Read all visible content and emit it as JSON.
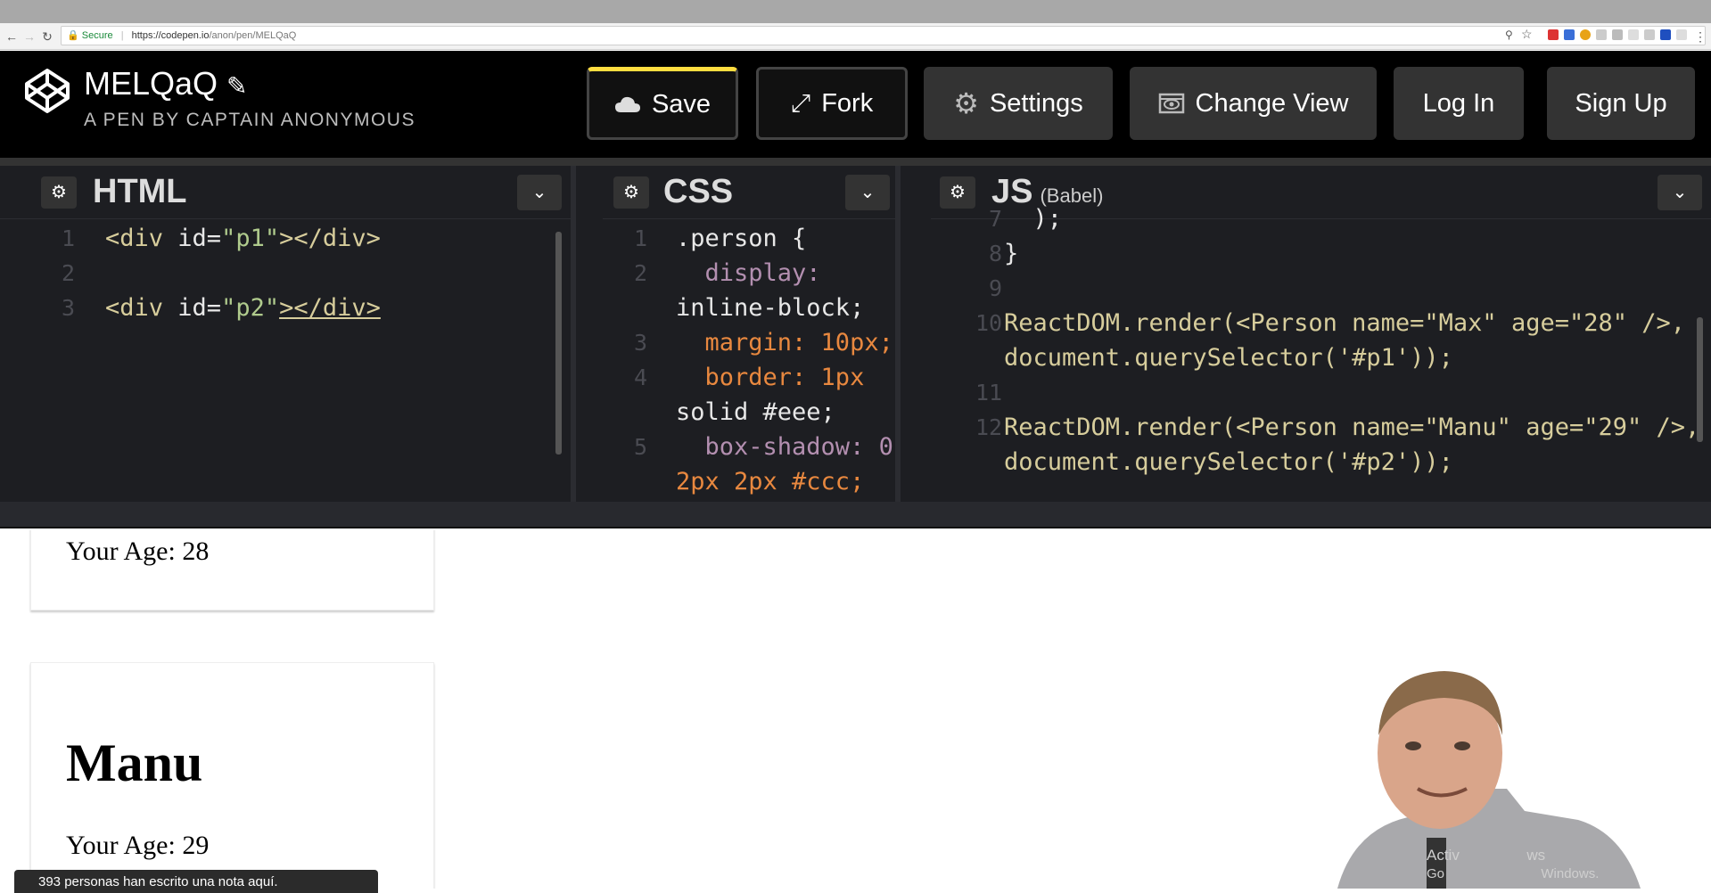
{
  "browser": {
    "secure_label": "Secure",
    "url_scheme": "https://",
    "url_host": "codepen.io",
    "url_path": "/anon/pen/MELQaQ"
  },
  "header": {
    "pen_title": "MELQaQ",
    "pen_subtitle": "A PEN BY CAPTAIN ANONYMOUS",
    "buttons": {
      "save": "Save",
      "fork": "Fork",
      "settings": "Settings",
      "change_view": "Change View",
      "log_in": "Log In",
      "sign_up": "Sign Up"
    }
  },
  "editors": {
    "html": {
      "title": "HTML",
      "lines": [
        {
          "n": "1",
          "parts": [
            [
              "tag",
              "<div "
            ],
            [
              "at",
              "id="
            ],
            [
              "str",
              "\"p1\""
            ],
            [
              "tag",
              "></div>"
            ]
          ]
        },
        {
          "n": "2",
          "parts": []
        },
        {
          "n": "3",
          "parts": [
            [
              "tag",
              "<div "
            ],
            [
              "at",
              "id="
            ],
            [
              "str",
              "\"p2\""
            ],
            [
              "tag",
              "></div>"
            ]
          ]
        }
      ]
    },
    "css": {
      "title": "CSS",
      "lines": [
        {
          "n": "1",
          "text": ".person {"
        },
        {
          "n": "2",
          "text": "  display:"
        },
        {
          "n": "",
          "text": "inline-block;"
        },
        {
          "n": "3",
          "text": "  margin: 10px;"
        },
        {
          "n": "4",
          "text": "  border: 1px"
        },
        {
          "n": "",
          "text": "solid #eee;"
        },
        {
          "n": "5",
          "text": "  box-shadow: 0"
        },
        {
          "n": "",
          "text": "2px 2px #ccc;"
        }
      ]
    },
    "js": {
      "title": "JS",
      "subtitle": "(Babel)",
      "lines": [
        {
          "n": "7",
          "text": "  );"
        },
        {
          "n": "8",
          "text": "}"
        },
        {
          "n": "9",
          "text": ""
        },
        {
          "n": "10",
          "text": "ReactDOM.render(<Person name=\"Max\" age=\"28\" />,"
        },
        {
          "n": "",
          "text": "document.querySelector('#p1'));"
        },
        {
          "n": "11",
          "text": ""
        },
        {
          "n": "12",
          "text": "ReactDOM.render(<Person name=\"Manu\" age=\"29\" />,"
        },
        {
          "n": "",
          "text": "document.querySelector('#p2'));"
        }
      ]
    }
  },
  "preview": {
    "card1_age": "Your Age: 28",
    "card2_name": "Manu",
    "card2_age": "Your Age: 29"
  },
  "toast": "393 personas han escrito una nota aquí.",
  "watermark": {
    "line1": "Activ                ws",
    "line2": "Go                          Windows."
  },
  "colors": {
    "accent": "#ffdd40",
    "editor_bg": "#1d1e22",
    "header_bg": "#000000"
  }
}
